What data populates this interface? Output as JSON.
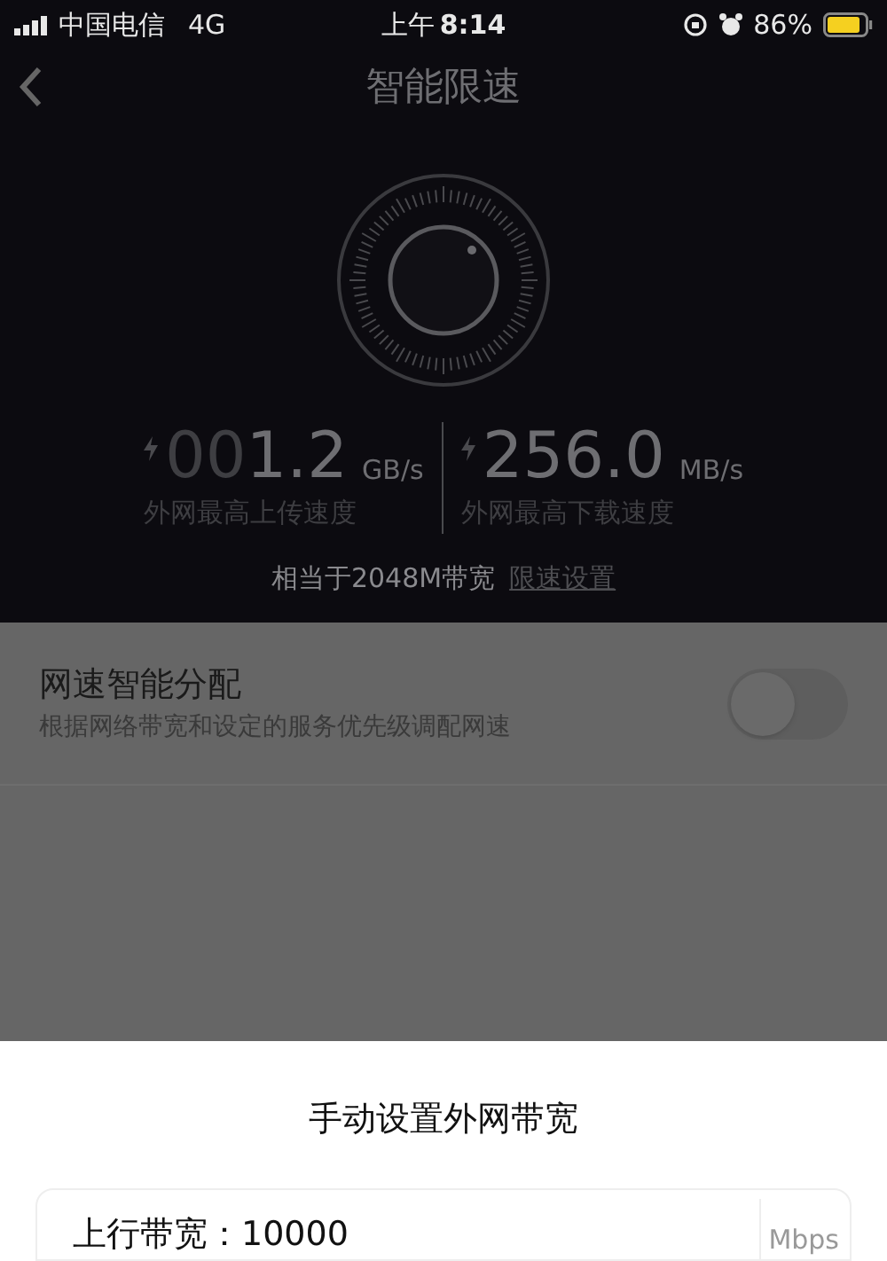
{
  "status_bar": {
    "carrier": "中国电信",
    "network": "4G",
    "time_prefix": "上午",
    "time": "8:14",
    "battery": "86%"
  },
  "nav": {
    "title": "智能限速"
  },
  "speeds": [
    {
      "prefix": "00",
      "value": "1.2",
      "unit": "GB/s",
      "label": "外网最高上传速度"
    },
    {
      "value": "256.0",
      "unit": "MB/s",
      "label": "外网最高下载速度"
    }
  ],
  "equivalent": {
    "text": "相当于2048M带宽",
    "link": "限速设置"
  },
  "setting": {
    "title": "网速智能分配",
    "description": "根据网络带宽和设定的服务优先级调配网速",
    "on": false
  },
  "sheet": {
    "title": "手动设置外网带宽",
    "field": {
      "label": "上行带宽：",
      "value": "10000",
      "unit": "Mbps"
    }
  }
}
